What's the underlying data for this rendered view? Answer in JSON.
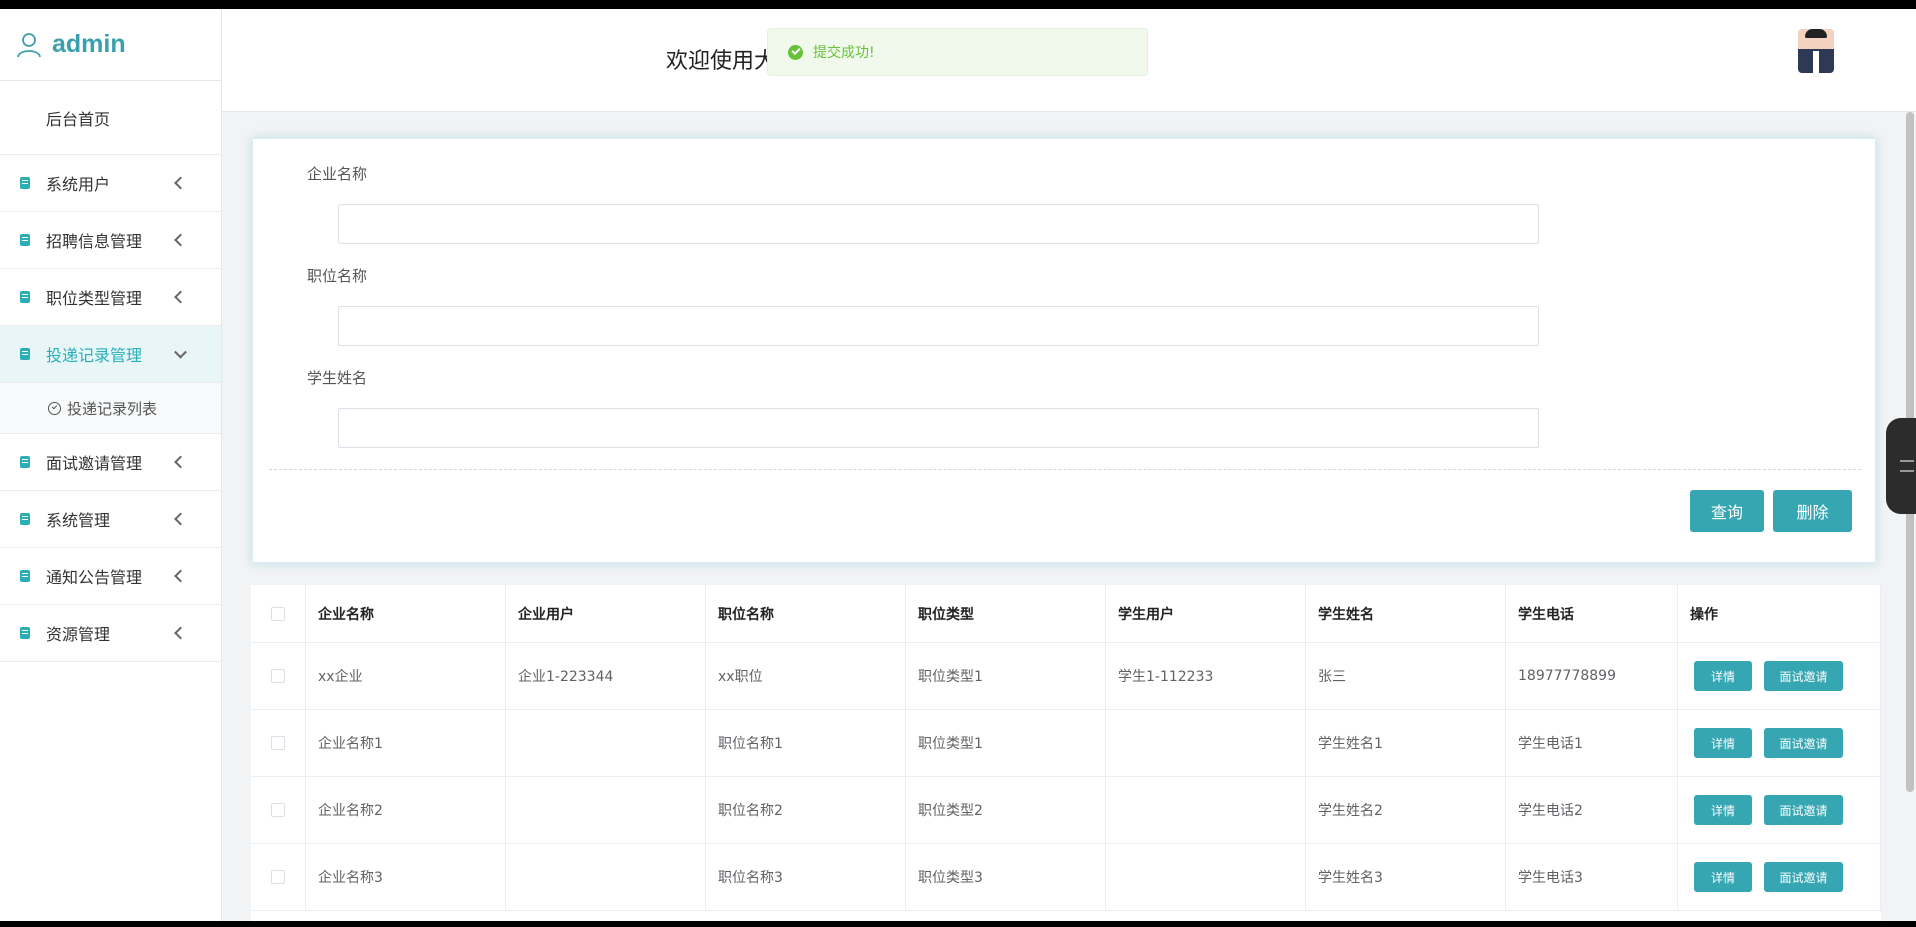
{
  "sidebar": {
    "brand": "admin",
    "home": "后台首页",
    "items": [
      {
        "label": "系统用户"
      },
      {
        "label": "招聘信息管理"
      },
      {
        "label": "职位类型管理"
      },
      {
        "label": "投递记录管理"
      },
      {
        "label": "面试邀请管理"
      },
      {
        "label": "系统管理"
      },
      {
        "label": "通知公告管理"
      },
      {
        "label": "资源管理"
      }
    ],
    "sub_item": "投递记录列表"
  },
  "header": {
    "welcome": "欢迎使用大"
  },
  "toast": {
    "message": "提交成功!"
  },
  "search": {
    "fields": [
      {
        "label": "企业名称",
        "value": ""
      },
      {
        "label": "职位名称",
        "value": ""
      },
      {
        "label": "学生姓名",
        "value": ""
      }
    ],
    "query_button": "查询",
    "delete_button": "删除"
  },
  "table": {
    "headers": [
      "企业名称",
      "企业用户",
      "职位名称",
      "职位类型",
      "学生用户",
      "学生姓名",
      "学生电话",
      "操作"
    ],
    "rows": [
      [
        "xx企业",
        "企业1-223344",
        "xx职位",
        "职位类型1",
        "学生1-112233",
        "张三",
        "18977778899"
      ],
      [
        "企业名称1",
        "",
        "职位名称1",
        "职位类型1",
        "",
        "学生姓名1",
        "学生电话1"
      ],
      [
        "企业名称2",
        "",
        "职位名称2",
        "职位类型2",
        "",
        "学生姓名2",
        "学生电话2"
      ],
      [
        "企业名称3",
        "",
        "职位名称3",
        "职位类型3",
        "",
        "学生姓名3",
        "学生电话3"
      ]
    ],
    "detail_label": "详情",
    "invite_label": "面试邀请"
  }
}
